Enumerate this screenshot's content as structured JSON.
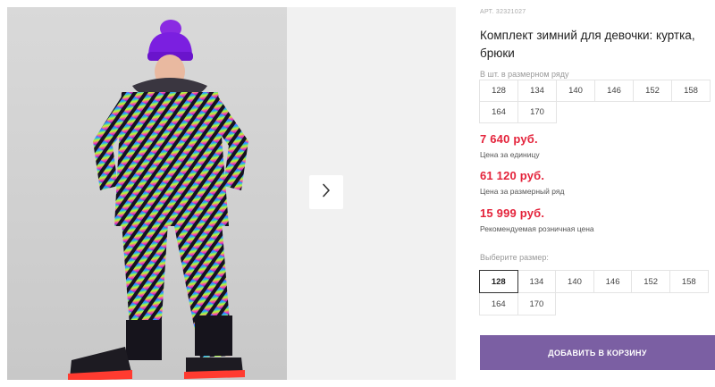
{
  "gallery": {
    "next_icon": "chevron-right-icon"
  },
  "product": {
    "sku": "АРТ. 32321027",
    "title": "Комплект зимний для девочки: куртка, брюки"
  },
  "size_row": {
    "label": "В шт. в размерном ряду",
    "sizes": [
      "128",
      "134",
      "140",
      "146",
      "152",
      "158",
      "164",
      "170"
    ]
  },
  "prices": {
    "unit_price": "7 640 руб.",
    "unit_caption": "Цена за единицу",
    "row_price": "61 120 руб.",
    "row_caption": "Цена за размерный ряд",
    "retail_price": "15 999 руб.",
    "retail_caption": "Рекомендуемая розничная цена",
    "price_color": "#e4233b"
  },
  "size_select": {
    "label": "Выберите размер:",
    "sizes": [
      "128",
      "134",
      "140",
      "146",
      "152",
      "158",
      "164",
      "170"
    ],
    "selected": "128"
  },
  "cart": {
    "button_label": "ДОБАВИТЬ В КОРЗИНУ",
    "button_color": "#7b5fa3"
  }
}
